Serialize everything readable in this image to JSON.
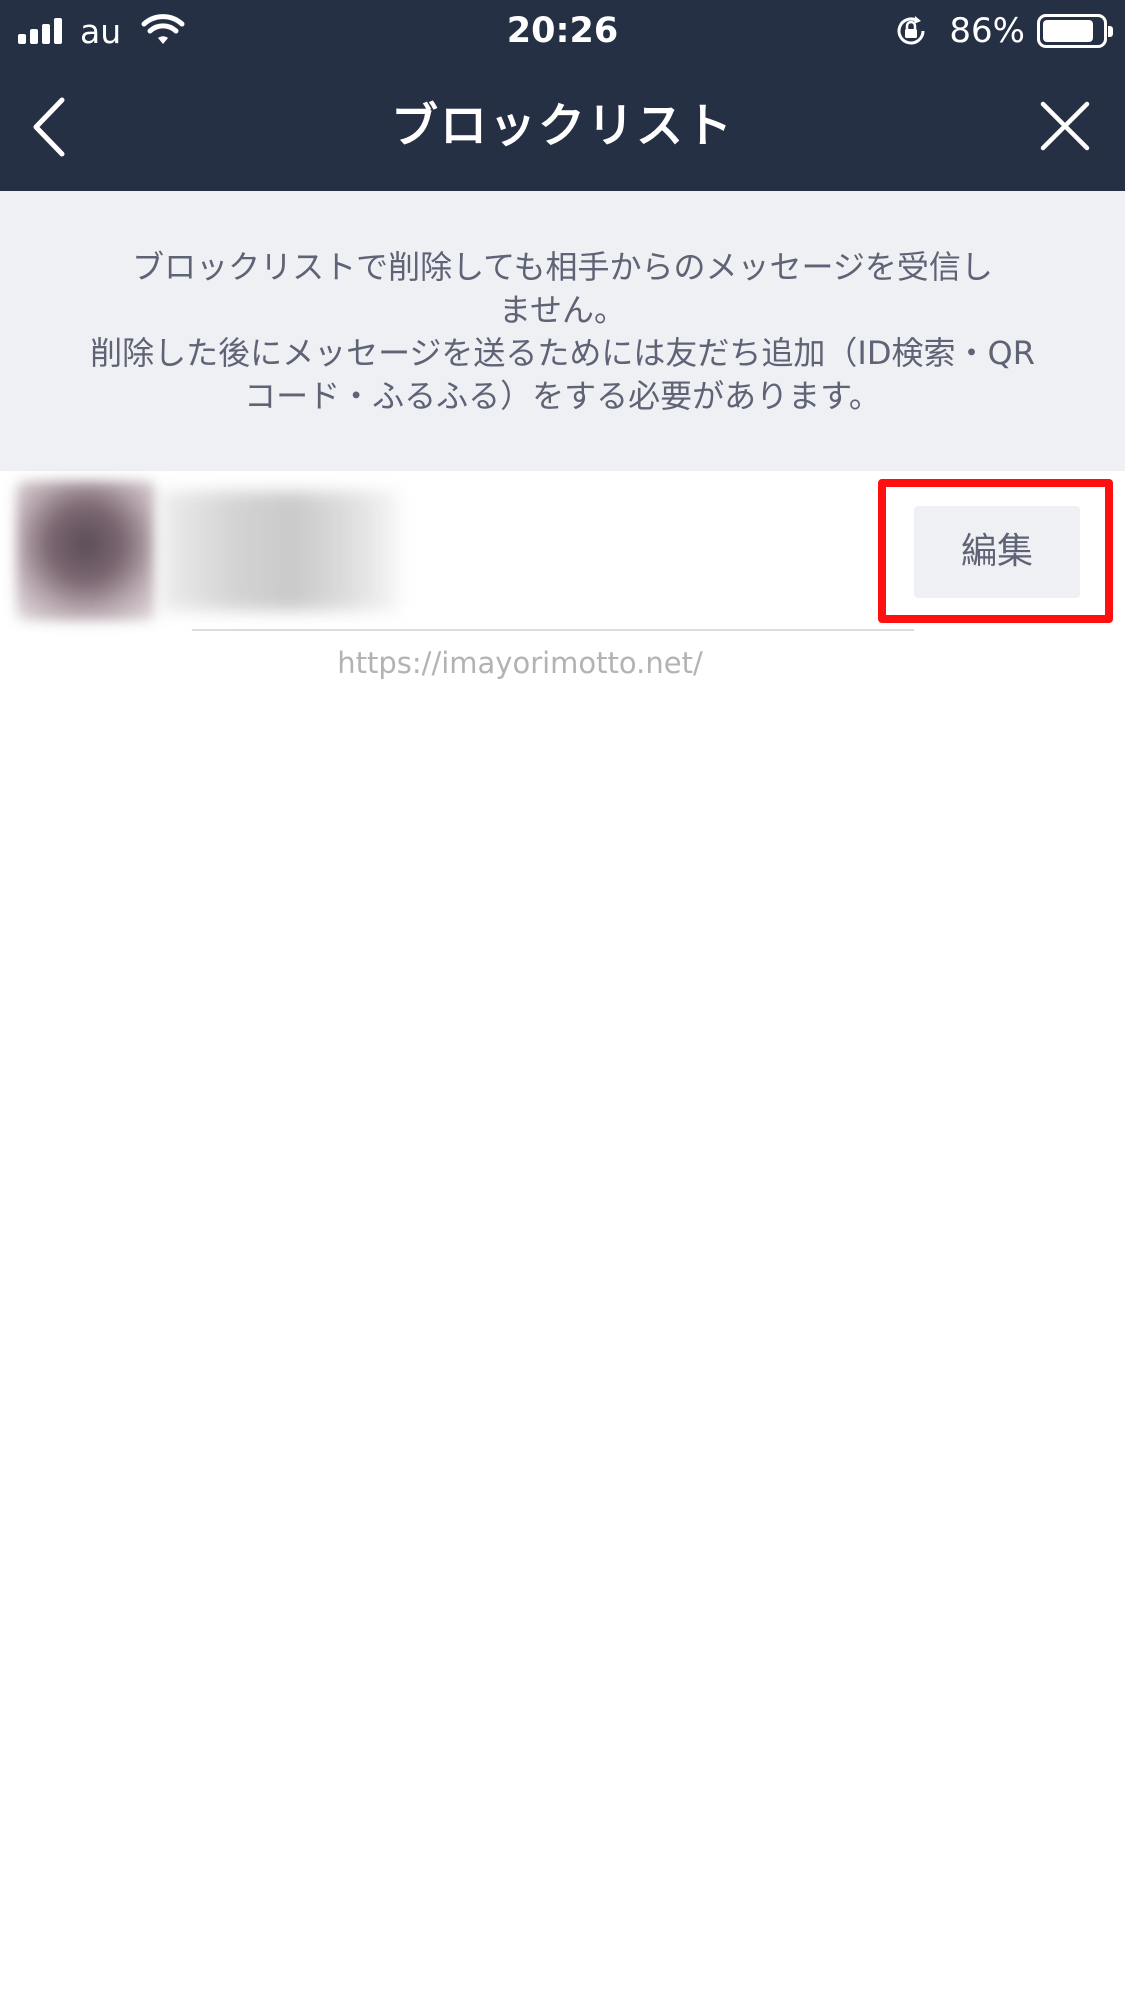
{
  "status_bar": {
    "carrier": "au",
    "time": "20:26",
    "battery_percent": "86%",
    "battery_level": 0.86
  },
  "nav": {
    "title": "ブロックリスト",
    "back_icon": "chevron-left-icon",
    "close_icon": "close-icon"
  },
  "notice": {
    "lines": [
      "ブロックリストで削除しても相手からのメッセージを受信し",
      "ません。",
      "削除した後にメッセージを送るためには友だち追加（ID検索・QR",
      "コード・ふるふる）をする必要があります。"
    ]
  },
  "list": {
    "edit_label": "編集"
  },
  "watermark": "https://imayorimotto.net/",
  "colors": {
    "header_bg": "#253045",
    "notice_bg": "#eff0f4",
    "highlight": "#ff1010"
  }
}
